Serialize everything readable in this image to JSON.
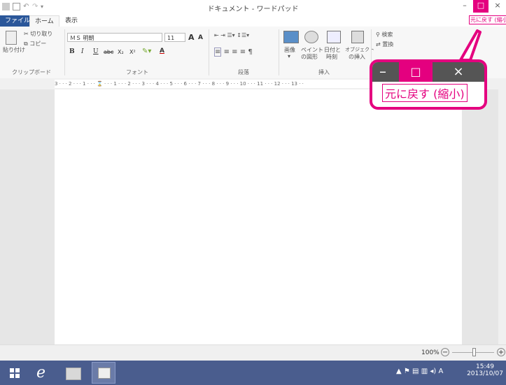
{
  "window": {
    "title": "ドキュメント - ワードパッド",
    "minimize_glyph": "–",
    "restore_glyph": "□",
    "close_glyph": "×",
    "restore_tooltip": "元に戻す (縮小)"
  },
  "tabs": [
    {
      "label": "ファイル",
      "active": false
    },
    {
      "label": "ホーム",
      "active": true
    },
    {
      "label": "表示",
      "active": false
    }
  ],
  "ribbon": {
    "clipboard": {
      "paste_label": "貼り付け",
      "cut_label": "切り取り",
      "copy_label": "コピー",
      "group_label": "クリップボード"
    },
    "font": {
      "font_name": "ＭＳ 明朝",
      "font_size": "11",
      "grow_label": "A",
      "shrink_label": "A",
      "bold": "B",
      "italic": "I",
      "underline": "U",
      "strike": "abc",
      "subscript": "X₂",
      "superscript": "X²",
      "color_label": "A",
      "group_label": "フォント"
    },
    "paragraph": {
      "group_label": "段落"
    },
    "insert": {
      "image_label": "画像",
      "paint_label_1": "ペイント",
      "paint_label_2": "の図形",
      "datetime_label_1": "日付と",
      "datetime_label_2": "時刻",
      "object_label_1": "オブジェクト",
      "object_label_2": "の挿入",
      "group_label": "挿入"
    },
    "editing": {
      "find_label": "検索",
      "replace_label": "置換"
    }
  },
  "ruler": {
    "text": "3 · · · 2 · · · 1 · · · ⌛ · · · 1 · · · 2 · · · 3 · · · 4 · · · 5 · · · 6 · · · 7 · · · 8 · · · 9 · · · 10 · · · 11 · · · 12 · · · 13 · ·"
  },
  "status": {
    "zoom": "100%",
    "zoom_out": "−",
    "zoom_in": "+"
  },
  "taskbar": {
    "time": "15:49",
    "date": "2013/10/07",
    "ime": "A"
  },
  "callout": {
    "minimize_glyph": "–",
    "restore_glyph": "□",
    "close_glyph": "×",
    "tooltip": "元に戻す (縮小)"
  },
  "colors": {
    "accent": "#e4007f",
    "tab_active": "#2b579a",
    "taskbar": "#4a5d8e",
    "titlebar_dark": "#555555"
  }
}
